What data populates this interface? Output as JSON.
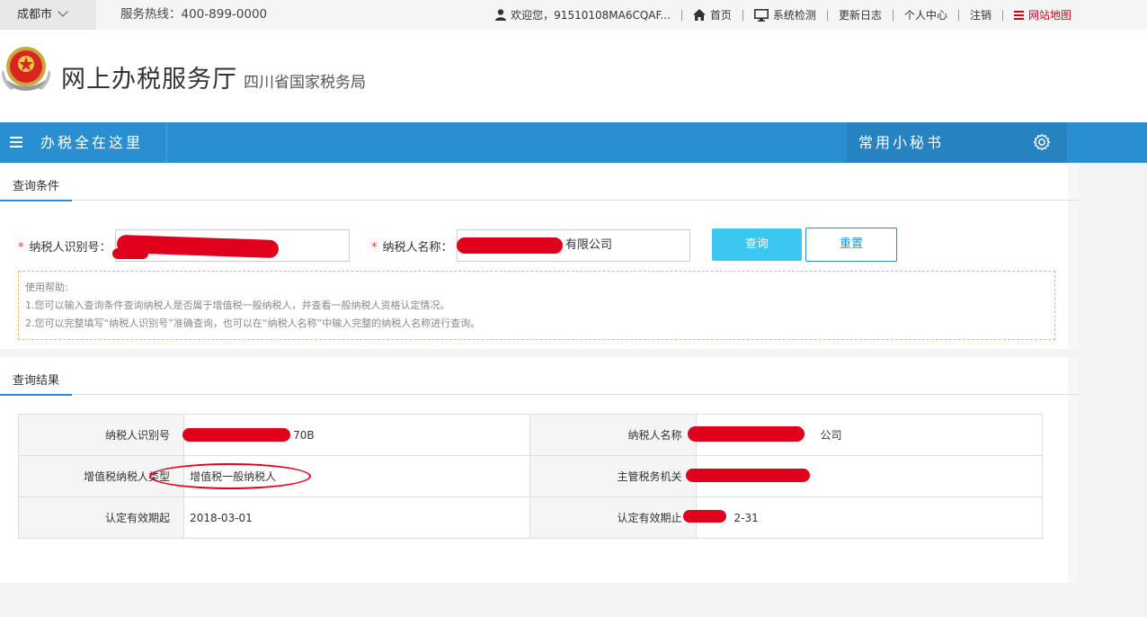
{
  "topbar": {
    "city": "成都市",
    "hotline": "服务热线：400-899-0000",
    "welcome": "欢迎您，91510108MA6CQAF...",
    "links": [
      "首页",
      "系统检测",
      "更新日志",
      "个人中心",
      "注销",
      "网站地图"
    ]
  },
  "header": {
    "title": "网上办税服务厅",
    "subtitle": "四川省国家税务局"
  },
  "nav": {
    "menu_label": "办税全在这里",
    "secretary_label": "常用小秘书"
  },
  "query": {
    "section_title": "查询条件",
    "taxpayer_id_label": "纳税人识别号：",
    "taxpayer_id_value": "",
    "taxpayer_name_label": "纳税人名称：",
    "taxpayer_name_value": "有限公司",
    "query_button": "查询",
    "reset_button": "重置",
    "help_title": "使用帮助:",
    "help_lines": [
      "1.您可以输入查询条件查询纳税人是否属于增值税一般纳税人，并查看一般纳税人资格认定情况。",
      "2.您可以完整填写“纳税人识别号”准确查询，也可以在“纳税人名称”中输入完整的纳税人名称进行查询。"
    ]
  },
  "result": {
    "section_title": "查询结果",
    "rows": [
      {
        "k1": "纳税人识别号",
        "v1": "70B",
        "k2": "纳税人名称",
        "v2": "公司"
      },
      {
        "k1": "增值税纳税人类型",
        "v1": "增值税一般纳税人",
        "k2": "主管税务机关",
        "v2": ""
      },
      {
        "k1": "认定有效期起",
        "v1": "2018-03-01",
        "k2": "认定有效期止",
        "v2": "2-31"
      }
    ]
  },
  "colors": {
    "nav_blue": "#2a8fd0",
    "query_button": "#3cc7f0",
    "redaction": "#e0001c"
  }
}
